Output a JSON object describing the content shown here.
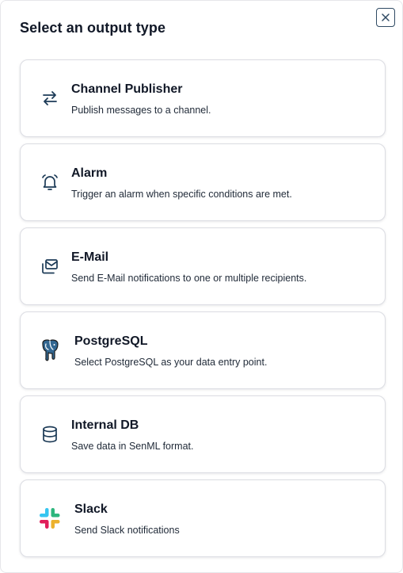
{
  "dialog": {
    "title": "Select an output type",
    "close_icon": "close-icon"
  },
  "options": [
    {
      "title": "Channel Publisher",
      "description": "Publish messages to a channel.",
      "icon": "arrows-swap-icon"
    },
    {
      "title": "Alarm",
      "description": "Trigger an alarm when specific conditions are met.",
      "icon": "bell-icon"
    },
    {
      "title": "E-Mail",
      "description": "Send E-Mail notifications to one or multiple recipients.",
      "icon": "mail-icon"
    },
    {
      "title": "PostgreSQL",
      "description": "Select PostgreSQL as your data entry point.",
      "icon": "postgresql-elephant-icon"
    },
    {
      "title": "Internal DB",
      "description": "Save data in SenML format.",
      "icon": "database-icon"
    },
    {
      "title": "Slack",
      "description": "Send Slack notifications",
      "icon": "slack-icon"
    }
  ],
  "colors": {
    "icon_stroke": "#1d3b57",
    "postgres_blue": "#336791",
    "slack_red": "#e01e5a",
    "slack_blue": "#36c5f0",
    "slack_green": "#2eb67d",
    "slack_yellow": "#ecb22e"
  }
}
